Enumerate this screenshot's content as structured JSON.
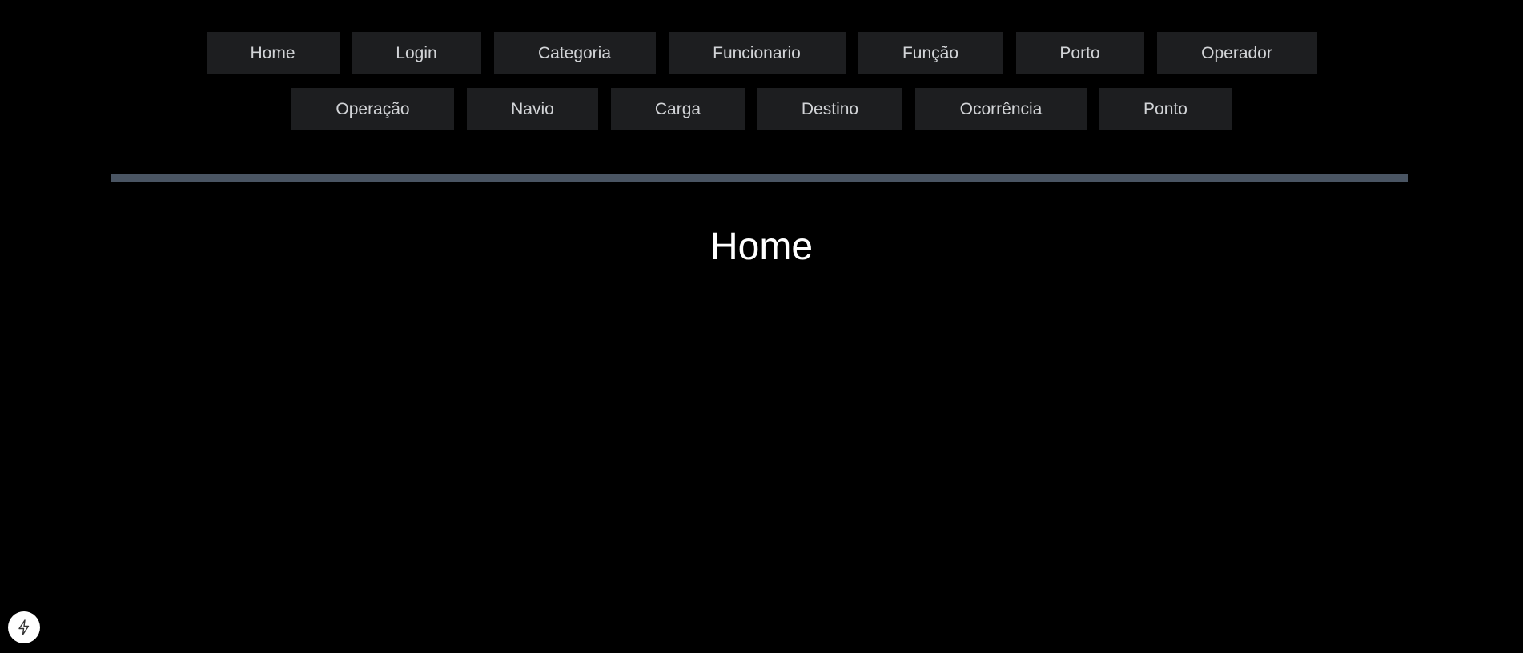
{
  "nav": {
    "row1": [
      {
        "label": "Home"
      },
      {
        "label": "Login"
      },
      {
        "label": "Categoria"
      },
      {
        "label": "Funcionario"
      },
      {
        "label": "Função"
      },
      {
        "label": "Porto"
      },
      {
        "label": "Operador"
      }
    ],
    "row2": [
      {
        "label": "Operação"
      },
      {
        "label": "Navio"
      },
      {
        "label": "Carga"
      },
      {
        "label": "Destino"
      },
      {
        "label": "Ocorrência"
      },
      {
        "label": "Ponto"
      }
    ]
  },
  "main": {
    "title": "Home"
  },
  "dev_badge": {
    "icon": "lightning-bolt-icon"
  },
  "colors": {
    "background": "#000000",
    "button_bg": "#1d1e20",
    "button_text": "#d2d4d7",
    "divider": "#4a5563",
    "title_text": "#ffffff"
  }
}
